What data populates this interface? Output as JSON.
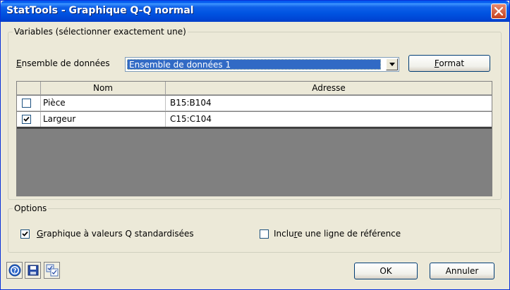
{
  "window": {
    "title": "StatTools - Graphique Q-Q normal"
  },
  "variables": {
    "legend": "Variables (sélectionner exactement une)",
    "dataset_label_pre": "",
    "dataset_label_acc": "E",
    "dataset_label_post": "nsemble de données",
    "dataset_selected": "Ensemble de données 1",
    "format_button_acc": "F",
    "format_button_post": "ormat",
    "columns": [
      "",
      "Nom",
      "Adresse"
    ],
    "rows": [
      {
        "checked": false,
        "name": "Pièce",
        "address": "B15:B104"
      },
      {
        "checked": true,
        "name": "Largeur",
        "address": "C15:C104"
      }
    ]
  },
  "options": {
    "legend": "Options",
    "standardized_acc": "G",
    "standardized_post": "raphique à valeurs Q standardisées",
    "standardized_checked": true,
    "reference_pre": "Inclu",
    "reference_acc": "r",
    "reference_post": "e une ligne de référence",
    "reference_checked": false
  },
  "footer": {
    "ok": "OK",
    "cancel": "Annuler"
  },
  "icons": {
    "help": "help-icon",
    "save": "save-icon",
    "copy": "copy-settings-icon"
  },
  "colors": {
    "titlebar": "#0053e1",
    "selection": "#316ac5",
    "grid_empty": "#808080"
  }
}
